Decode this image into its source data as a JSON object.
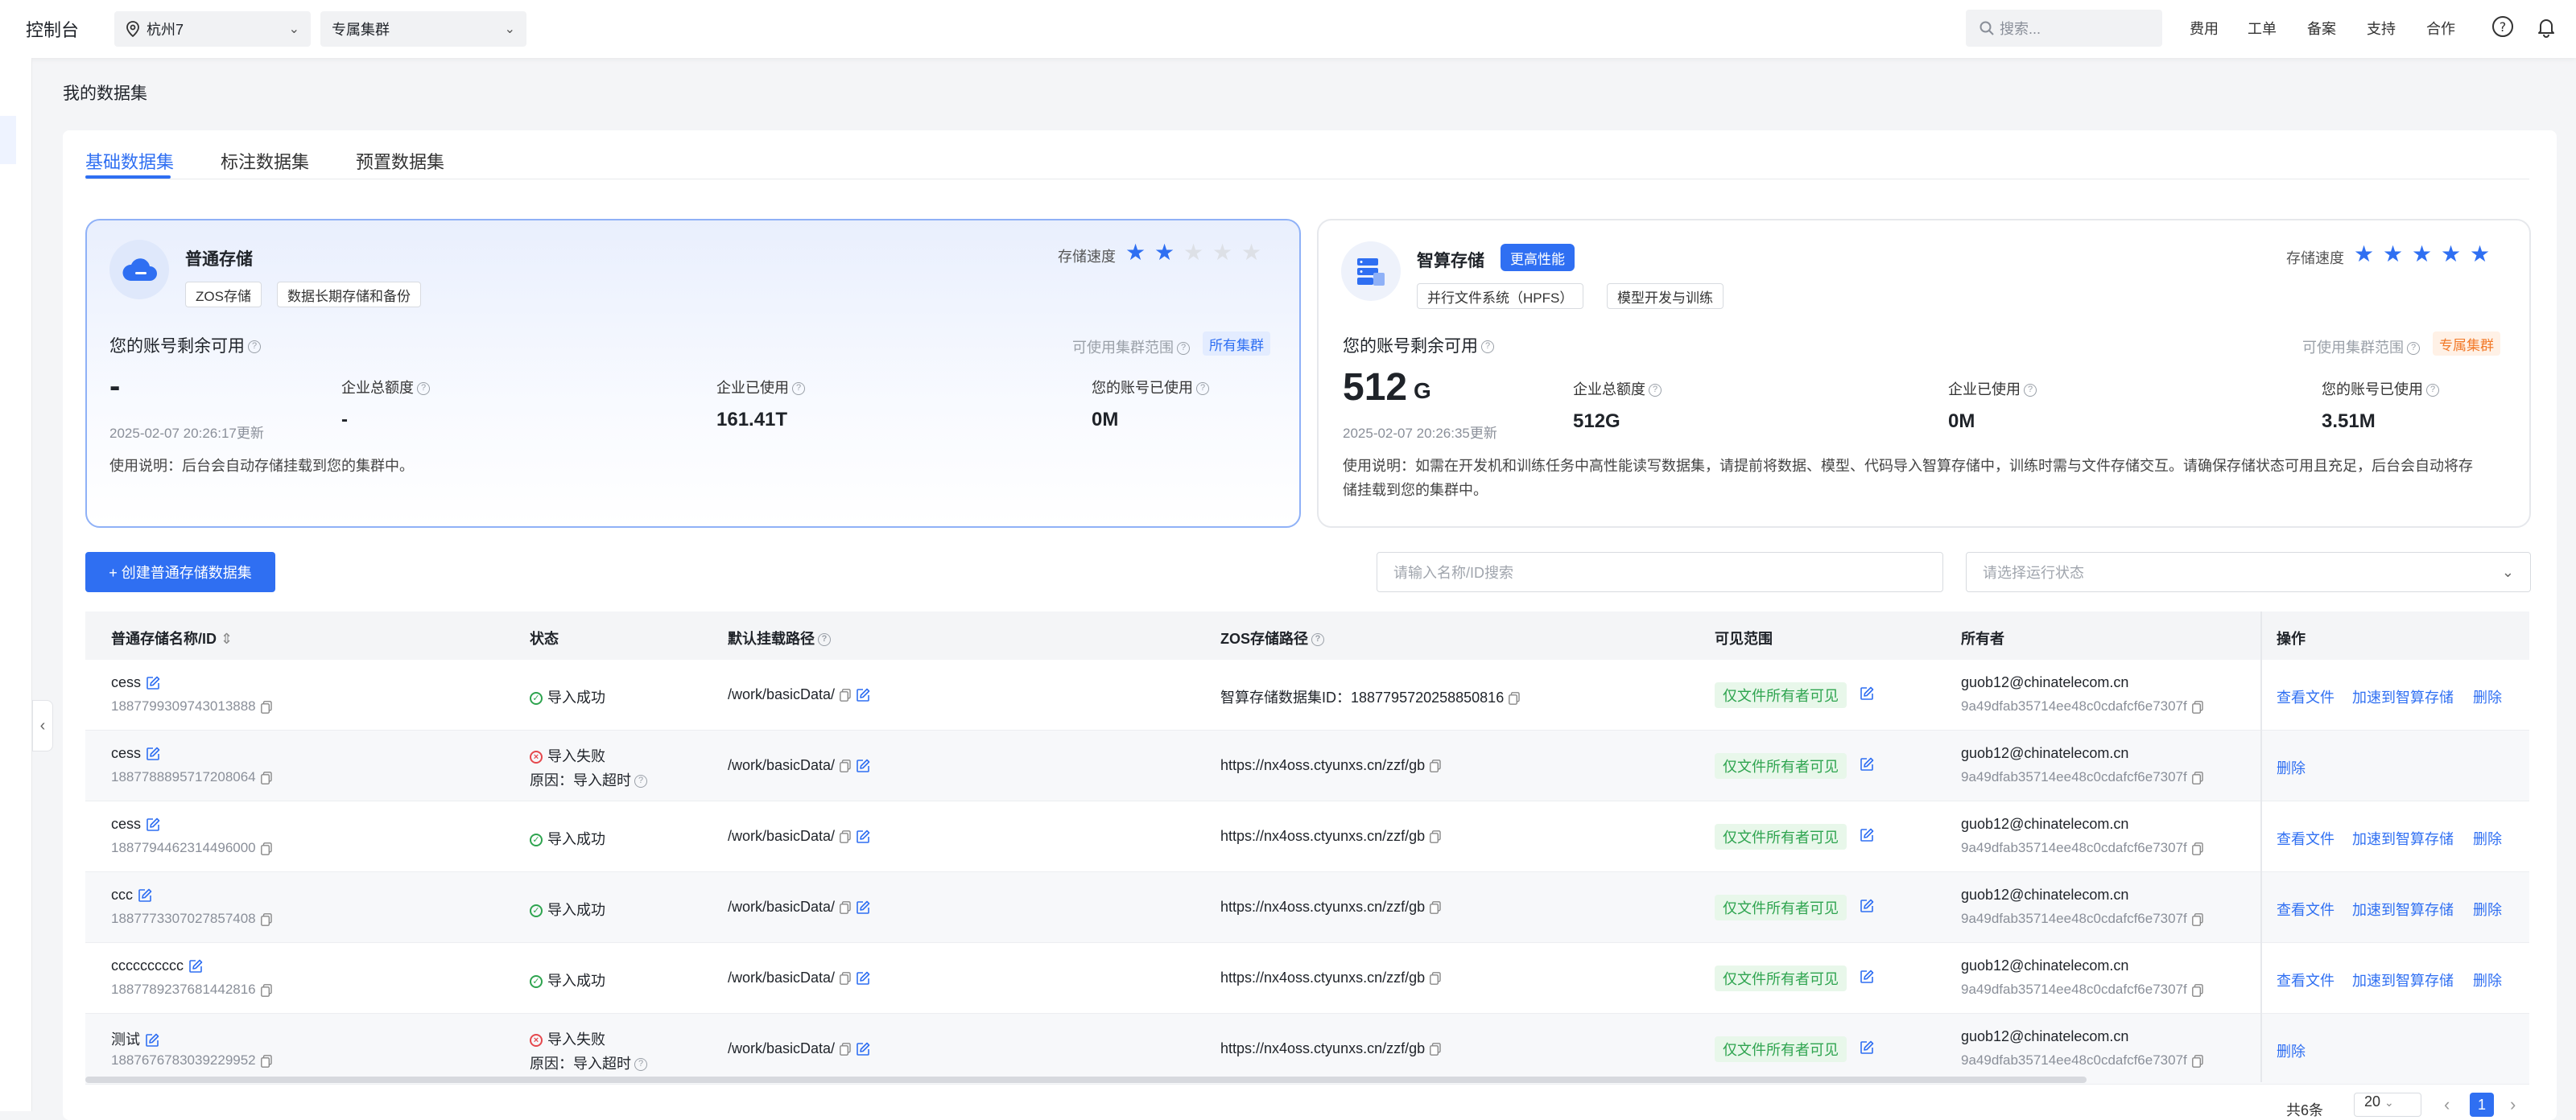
{
  "topbar": {
    "brand": "控制台",
    "region": "杭州7",
    "cluster": "专属集群",
    "search_placeholder": "搜索...",
    "links": [
      "费用",
      "工单",
      "备案",
      "支持",
      "合作"
    ]
  },
  "page": {
    "title": "我的数据集"
  },
  "tabs": [
    "基础数据集",
    "标注数据集",
    "预置数据集"
  ],
  "cards": [
    {
      "name": "普通存储",
      "chips": [
        "ZOS存储",
        "数据长期存储和备份"
      ],
      "speed_label": "存储速度",
      "speed_stars": 2,
      "remain_label": "您的账号剩余可用",
      "remain_value": "-",
      "remain_unit": "",
      "updated": "2025-02-07 20:26:17更新",
      "range_label": "可使用集群范围",
      "range_tag": "所有集群",
      "stats": [
        {
          "label": "企业总额度",
          "value": "-"
        },
        {
          "label": "企业已使用",
          "value": "161.41T"
        },
        {
          "label": "您的账号已使用",
          "value": "0M"
        }
      ],
      "note": "使用说明：后台会自动存储挂载到您的集群中。"
    },
    {
      "name": "智算存储",
      "badge": "更高性能",
      "chips": [
        "并行文件系统（HPFS）",
        "模型开发与训练"
      ],
      "speed_label": "存储速度",
      "speed_stars": 5,
      "remain_label": "您的账号剩余可用",
      "remain_value": "512",
      "remain_unit": "G",
      "updated": "2025-02-07 20:26:35更新",
      "range_label": "可使用集群范围",
      "range_tag": "专属集群",
      "stats": [
        {
          "label": "企业总额度",
          "value": "512G"
        },
        {
          "label": "企业已使用",
          "value": "0M"
        },
        {
          "label": "您的账号已使用",
          "value": "3.51M"
        }
      ],
      "note_line1": "使用说明：如需在开发机和训练任务中高性能读写数据集，请提前将数据、模型、代码导入智算存储中，训练时需与文件存储交互。请确保存储状态可用且充足，后台会自动将存",
      "note_line2": "储挂载到您的集群中。"
    }
  ],
  "toolbar": {
    "create_label": "+ 创建普通存储数据集",
    "search_placeholder": "请输入名称/ID搜索",
    "status_placeholder": "请选择运行状态"
  },
  "table": {
    "headers": [
      "普通存储名称/ID",
      "状态",
      "默认挂载路径",
      "ZOS存储路径",
      "可见范围",
      "所有者",
      "操作"
    ],
    "rows": [
      {
        "name": "cess",
        "id": "1887799309743013888",
        "status": "导入成功",
        "status_ok": true,
        "reason": "",
        "path": "/work/basicData/",
        "zos": "智算存储数据集ID：1887795720258850816",
        "scope": "仅文件所有者可见",
        "owner": "guob12@chinatelecom.cn",
        "owner_id": "9a49dfab35714ee48c0cdafcf6e7307f",
        "actions": [
          "查看文件",
          "加速到智算存储",
          "删除"
        ]
      },
      {
        "name": "cess",
        "id": "1887788895717208064",
        "status": "导入失败",
        "status_ok": false,
        "reason": "原因：导入超时",
        "path": "/work/basicData/",
        "zos": "https://nx4oss.ctyunxs.cn/zzf/gb",
        "scope": "仅文件所有者可见",
        "owner": "guob12@chinatelecom.cn",
        "owner_id": "9a49dfab35714ee48c0cdafcf6e7307f",
        "actions": [
          "删除"
        ]
      },
      {
        "name": "cess",
        "id": "1887794462314496000",
        "status": "导入成功",
        "status_ok": true,
        "reason": "",
        "path": "/work/basicData/",
        "zos": "https://nx4oss.ctyunxs.cn/zzf/gb",
        "scope": "仅文件所有者可见",
        "owner": "guob12@chinatelecom.cn",
        "owner_id": "9a49dfab35714ee48c0cdafcf6e7307f",
        "actions": [
          "查看文件",
          "加速到智算存储",
          "删除"
        ]
      },
      {
        "name": "ccc",
        "id": "1887773307027857408",
        "status": "导入成功",
        "status_ok": true,
        "reason": "",
        "path": "/work/basicData/",
        "zos": "https://nx4oss.ctyunxs.cn/zzf/gb",
        "scope": "仅文件所有者可见",
        "owner": "guob12@chinatelecom.cn",
        "owner_id": "9a49dfab35714ee48c0cdafcf6e7307f",
        "actions": [
          "查看文件",
          "加速到智算存储",
          "删除"
        ]
      },
      {
        "name": "cccccccccc",
        "id": "1887789237681442816",
        "status": "导入成功",
        "status_ok": true,
        "reason": "",
        "path": "/work/basicData/",
        "zos": "https://nx4oss.ctyunxs.cn/zzf/gb",
        "scope": "仅文件所有者可见",
        "owner": "guob12@chinatelecom.cn",
        "owner_id": "9a49dfab35714ee48c0cdafcf6e7307f",
        "actions": [
          "查看文件",
          "加速到智算存储",
          "删除"
        ]
      },
      {
        "name": "测试",
        "id": "1887676783039229952",
        "status": "导入失败",
        "status_ok": false,
        "reason": "原因：导入超时",
        "path": "/work/basicData/",
        "zos": "https://nx4oss.ctyunxs.cn/zzf/gb",
        "scope": "仅文件所有者可见",
        "owner": "guob12@chinatelecom.cn",
        "owner_id": "9a49dfab35714ee48c0cdafcf6e7307f",
        "actions": [
          "删除"
        ]
      }
    ]
  },
  "pagination": {
    "total": "共6条",
    "page_size": "20",
    "current_page": "1"
  },
  "colors": {
    "accent": "#2f6ff2",
    "success": "#2ea44f",
    "error": "#e5484d",
    "warning": "#f27a2a"
  }
}
